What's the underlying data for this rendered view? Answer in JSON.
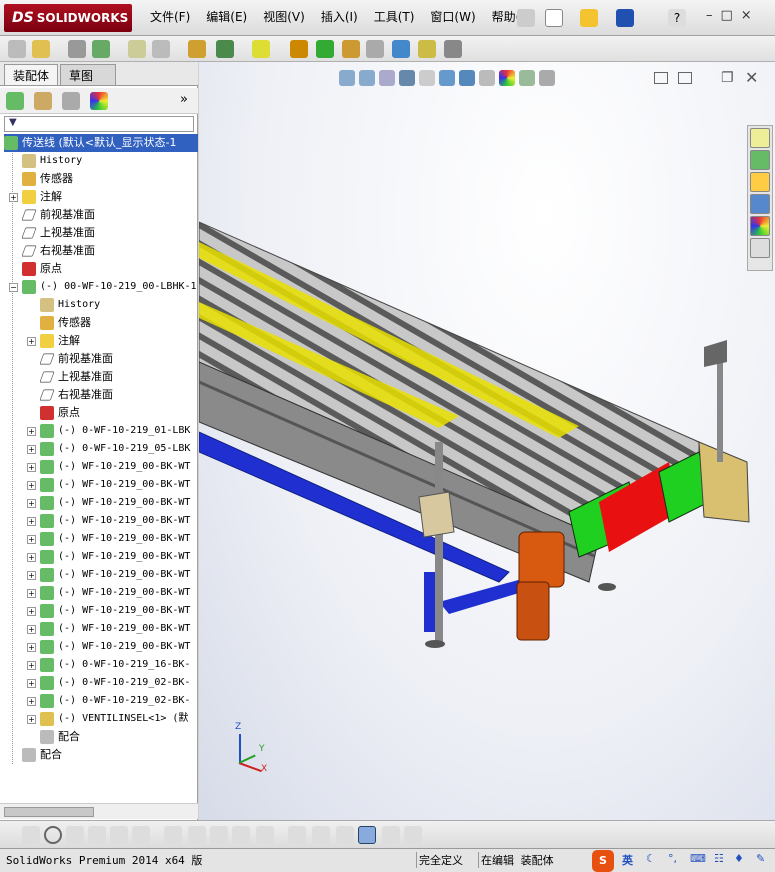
{
  "app": {
    "logo": "SOLIDWORKS"
  },
  "menu": [
    "文件(F)",
    "编辑(E)",
    "视图(V)",
    "插入(I)",
    "工具(T)",
    "窗口(W)",
    "帮助(H)"
  ],
  "window_controls": [
    "–",
    "□",
    "×"
  ],
  "panel_tabs": {
    "assembly": "装配体",
    "sketch": "草图"
  },
  "tree": {
    "root": "传送线 (默认<默认_显示状态-1",
    "items": [
      {
        "label": "History",
        "icon": "history-icon",
        "level": 1
      },
      {
        "label": "传感器",
        "icon": "sensor-icon",
        "level": 1
      },
      {
        "label": "注解",
        "icon": "annotation-icon",
        "level": 1
      },
      {
        "label": "前视基准面",
        "icon": "plane-icon",
        "level": 1
      },
      {
        "label": "上视基准面",
        "icon": "plane-icon",
        "level": 1
      },
      {
        "label": "右视基准面",
        "icon": "plane-icon",
        "level": 1
      },
      {
        "label": "原点",
        "icon": "origin-icon",
        "level": 1
      },
      {
        "label": "(-) 00-WF-10-219_00-LBHK-1",
        "icon": "assembly-icon",
        "level": 1
      },
      {
        "label": "History",
        "icon": "history-icon",
        "level": 2
      },
      {
        "label": "传感器",
        "icon": "sensor-icon",
        "level": 2
      },
      {
        "label": "注解",
        "icon": "annotation-icon",
        "level": 2
      },
      {
        "label": "前视基准面",
        "icon": "plane-icon",
        "level": 2
      },
      {
        "label": "上视基准面",
        "icon": "plane-icon",
        "level": 2
      },
      {
        "label": "右视基准面",
        "icon": "plane-icon",
        "level": 2
      },
      {
        "label": "原点",
        "icon": "origin-icon",
        "level": 2
      },
      {
        "label": "(-) 0-WF-10-219_01-LBK",
        "icon": "assembly-icon",
        "level": 2
      },
      {
        "label": "(-) 0-WF-10-219_05-LBK",
        "icon": "assembly-icon",
        "level": 2
      },
      {
        "label": "(-) WF-10-219_00-BK-WT",
        "icon": "assembly-icon",
        "level": 2
      },
      {
        "label": "(-) WF-10-219_00-BK-WT",
        "icon": "assembly-icon",
        "level": 2
      },
      {
        "label": "(-) WF-10-219_00-BK-WT",
        "icon": "assembly-icon",
        "level": 2
      },
      {
        "label": "(-) WF-10-219_00-BK-WT",
        "icon": "assembly-icon",
        "level": 2
      },
      {
        "label": "(-) WF-10-219_00-BK-WT",
        "icon": "assembly-icon",
        "level": 2
      },
      {
        "label": "(-) WF-10-219_00-BK-WT",
        "icon": "assembly-icon",
        "level": 2
      },
      {
        "label": "(-) WF-10-219_00-BK-WT",
        "icon": "assembly-icon",
        "level": 2
      },
      {
        "label": "(-) WF-10-219_00-BK-WT",
        "icon": "assembly-icon",
        "level": 2
      },
      {
        "label": "(-) WF-10-219_00-BK-WT",
        "icon": "assembly-icon",
        "level": 2
      },
      {
        "label": "(-) WF-10-219_00-BK-WT",
        "icon": "assembly-icon",
        "level": 2
      },
      {
        "label": "(-) WF-10-219_00-BK-WT",
        "icon": "assembly-icon",
        "level": 2
      },
      {
        "label": "(-) 0-WF-10-219_16-BK-",
        "icon": "assembly-icon",
        "level": 2
      },
      {
        "label": "(-) 0-WF-10-219_02-BK-",
        "icon": "assembly-icon",
        "level": 2
      },
      {
        "label": "(-) 0-WF-10-219_02-BK-",
        "icon": "assembly-icon",
        "level": 2
      },
      {
        "label": "(-) VENTILINSEL<1> (默",
        "icon": "part-icon",
        "level": 2
      },
      {
        "label": "配合",
        "icon": "mate-icon",
        "level": 2
      },
      {
        "label": "配合",
        "icon": "mate-icon",
        "level": 1
      }
    ]
  },
  "triad": {
    "x": "X",
    "y": "Y",
    "z": "Z"
  },
  "status": {
    "product": "SolidWorks Premium 2014 x64 版",
    "definition": "完全定义",
    "mode": "在编辑 装配体",
    "ime": "英"
  },
  "colors": {
    "roller_yellow": "#e8e000",
    "frame_blue": "#2030d0",
    "motor_orange": "#d85a10",
    "belt_green": "#20d020",
    "belt_red": "#e81010"
  }
}
